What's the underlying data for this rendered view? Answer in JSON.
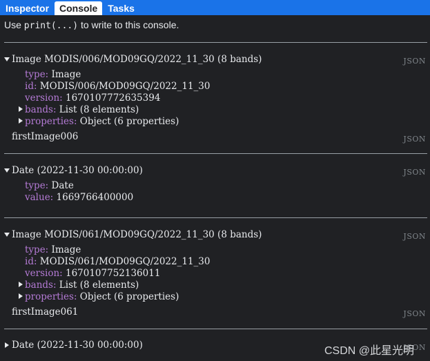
{
  "tabs": [
    "Inspector",
    "Console",
    "Tasks"
  ],
  "hint": {
    "prefix": "Use ",
    "code": "print(...)",
    "suffix": " to write to this console."
  },
  "json_label": "JSON",
  "entries": [
    {
      "header": "Image MODIS/006/MOD09GQ/2022_11_30 (8 bands)",
      "props": [
        {
          "key": "type:",
          "val": " Image"
        },
        {
          "key": "id:",
          "val": " MODIS/006/MOD09GQ/2022_11_30"
        },
        {
          "key": "version:",
          "val": " 1670107772635394"
        },
        {
          "key": "bands:",
          "val": " List (8 elements)"
        },
        {
          "key": "properties:",
          "val": " Object (6 properties)"
        }
      ],
      "label": "firstImage006"
    },
    {
      "header": "Date (2022-11-30 00:00:00)",
      "props": [
        {
          "key": "type:",
          "val": " Date"
        },
        {
          "key": "value:",
          "val": " 1669766400000"
        }
      ]
    },
    {
      "header": "Image MODIS/061/MOD09GQ/2022_11_30 (8 bands)",
      "props": [
        {
          "key": "type:",
          "val": " Image"
        },
        {
          "key": "id:",
          "val": " MODIS/061/MOD09GQ/2022_11_30"
        },
        {
          "key": "version:",
          "val": " 1670107752136011"
        },
        {
          "key": "bands:",
          "val": " List (8 elements)"
        },
        {
          "key": "properties:",
          "val": " Object (6 properties)"
        }
      ],
      "label": "firstImage061"
    },
    {
      "header": "Date (2022-11-30 00:00:00)"
    }
  ],
  "watermark": "CSDN @此星光明"
}
